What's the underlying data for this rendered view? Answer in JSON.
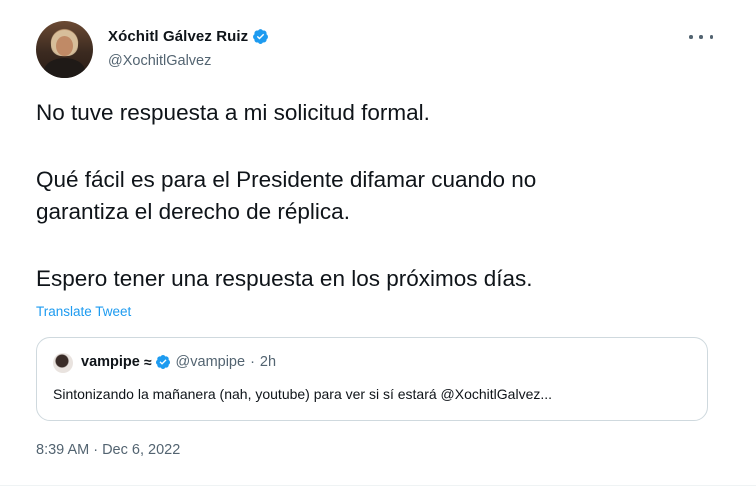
{
  "author": {
    "display_name": "Xóchitl Gálvez Ruiz",
    "handle": "@XochitlGalvez"
  },
  "tweet": {
    "paragraph_1": "No tuve respuesta a mi solicitud formal.",
    "paragraph_2_line_1": "Qué fácil es para el Presidente difamar cuando no",
    "paragraph_2_line_2": "garantiza el derecho de réplica.",
    "paragraph_3": "Espero tener una respuesta en los próximos días.",
    "translate_label": "Translate Tweet",
    "timestamp": "8:39 AM · Dec 6, 2022"
  },
  "quoted_tweet": {
    "display_name": "vampipe",
    "name_suffix": "≈",
    "handle": "@vampipe",
    "separator": "·",
    "time": "2h",
    "text": "Sintonizando la mañanera (nah, youtube) para ver si sí estará @XochitlGalvez..."
  },
  "icons": {
    "verified": "verified-badge-icon",
    "more": "more-options-icon"
  },
  "colors": {
    "accent": "#1d9bf0",
    "text_primary": "#0f1419",
    "text_secondary": "#536471",
    "border": "#cfd9de"
  }
}
